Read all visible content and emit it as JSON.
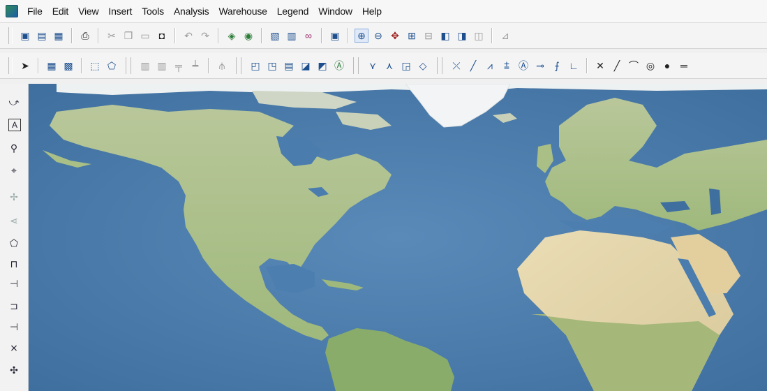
{
  "menubar": {
    "items": [
      "File",
      "Edit",
      "View",
      "Insert",
      "Tools",
      "Analysis",
      "Warehouse",
      "Legend",
      "Window",
      "Help"
    ]
  },
  "toolbar1": {
    "icons": [
      "open-map-icon",
      "save-icon",
      "layer-control-icon",
      "print-icon",
      "cut-icon",
      "copy-icon",
      "paste-icon",
      "camera-icon",
      "undo-icon",
      "redo-icon",
      "layer-add-icon",
      "layer-style-icon",
      "select-query-icon",
      "attribute-table-icon",
      "link-icon",
      "map-window-icon",
      "zoom-in-icon",
      "zoom-out-icon",
      "pan-icon",
      "full-extent-icon",
      "previous-extent-icon",
      "next-extent-icon",
      "refresh-icon",
      "identify-icon",
      "measure-icon"
    ]
  },
  "toolbar2": {
    "icons": [
      "select-arrow-icon",
      "select-region-icon",
      "select-layer-icon",
      "select-rect-icon",
      "select-polygon-icon",
      "grid-icon",
      "grid2-icon",
      "align-icon",
      "distribute-icon",
      "snap-icon",
      "new-layer-icon",
      "edit-layer-icon",
      "table-icon",
      "query-icon",
      "style-icon",
      "label-icon",
      "node-edit-icon",
      "node-add-icon",
      "feature-icon",
      "reshape-icon",
      "intersect-icon",
      "line-icon",
      "polyline-icon",
      "offset-icon",
      "text-box-icon",
      "join-icon",
      "split-icon",
      "angle-icon",
      "delete-node-icon",
      "straight-line-icon",
      "curve-icon",
      "ring-icon",
      "dot-icon",
      "equals-icon"
    ]
  },
  "lefttools": {
    "icons": [
      "rotate-icon",
      "text-tool-icon",
      "magnifier-icon",
      "pin-icon",
      "move-point-icon",
      "snap-arrow-icon",
      "polygon-draw-icon",
      "flag-icon",
      "tee-icon",
      "flag2-icon",
      "tee-left-icon",
      "cross-point-icon",
      "compass-icon"
    ]
  },
  "colors": {
    "ocean": "#4f7fae",
    "land": "#c8cc98",
    "desert": "#e6d7ad",
    "ice": "#f2f4f5",
    "toolbar_bg": "#f4f4f4"
  }
}
